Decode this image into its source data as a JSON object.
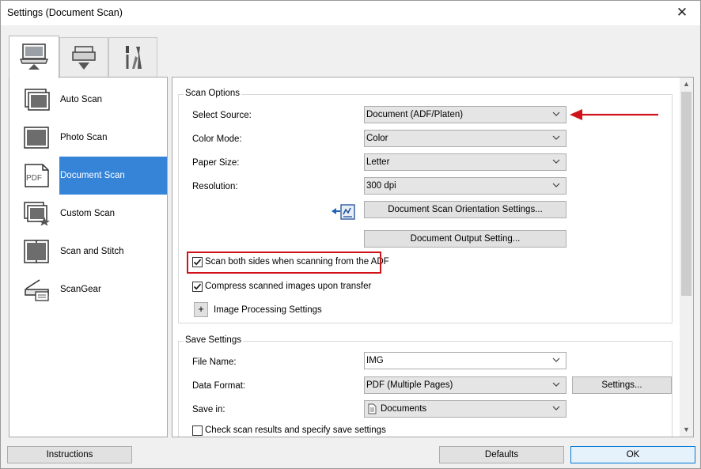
{
  "window": {
    "title": "Settings (Document Scan)",
    "close_glyph": "✕"
  },
  "top_tabs": [
    {
      "name": "scan-from-computer-tab",
      "icon": "computer-icon",
      "active": true
    },
    {
      "name": "scan-from-panel-tab",
      "icon": "scanner-down-icon",
      "active": false
    },
    {
      "name": "general-settings-tab",
      "icon": "tools-icon",
      "active": false
    }
  ],
  "nav": {
    "items": [
      {
        "label": "Auto Scan",
        "icon": "auto-scan-icon"
      },
      {
        "label": "Photo Scan",
        "icon": "photo-scan-icon"
      },
      {
        "label": "Document Scan",
        "icon": "pdf-document-icon",
        "selected": true
      },
      {
        "label": "Custom Scan",
        "icon": "custom-scan-icon"
      },
      {
        "label": "Scan and Stitch",
        "icon": "scan-stitch-icon"
      },
      {
        "label": "ScanGear",
        "icon": "scangear-icon"
      }
    ]
  },
  "scan_options": {
    "title": "Scan Options",
    "select_source": {
      "label": "Select Source:",
      "value": "Document (ADF/Platen)"
    },
    "color_mode": {
      "label": "Color Mode:",
      "value": "Color"
    },
    "paper_size": {
      "label": "Paper Size:",
      "value": "Letter"
    },
    "resolution": {
      "label": "Resolution:",
      "value": "300 dpi"
    },
    "orientation_button": "Document Scan Orientation Settings...",
    "output_button": "Document Output Setting...",
    "scan_both_sides": {
      "label": "Scan both sides when scanning from the ADF",
      "checked": true
    },
    "compress": {
      "label": "Compress scanned images upon transfer",
      "checked": true
    },
    "image_processing": {
      "expander": "+",
      "label": "Image Processing Settings"
    }
  },
  "save_settings": {
    "title": "Save Settings",
    "file_name": {
      "label": "File Name:",
      "value": "IMG"
    },
    "data_format": {
      "label": "Data Format:",
      "value": "PDF (Multiple Pages)",
      "settings_button": "Settings..."
    },
    "save_in": {
      "label": "Save in:",
      "value": "Documents"
    },
    "check_results": {
      "label": "Check scan results and specify save settings",
      "checked": false
    }
  },
  "footer": {
    "instructions": "Instructions",
    "defaults": "Defaults",
    "ok": "OK"
  },
  "colors": {
    "selection_blue": "#3584d8",
    "annotation_red": "#d0121a",
    "ok_border": "#0078d7"
  }
}
